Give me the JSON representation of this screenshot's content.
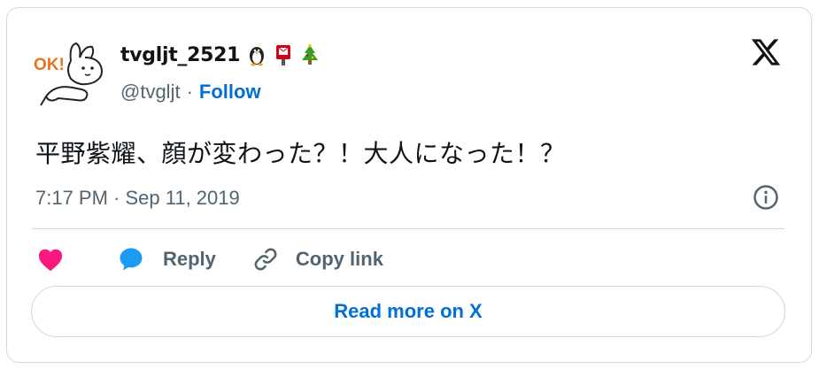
{
  "author": {
    "display_name": "tvgljt_2521",
    "name_emojis": [
      "penguin-emoji",
      "mailbox-emoji",
      "christmas-tree-emoji"
    ],
    "handle": "@tvgljt",
    "separator": "·",
    "follow_label": "Follow",
    "avatar_text": "OK!"
  },
  "tweet": {
    "text": "平野紫耀、顔が変わった？！大人になった！？",
    "timestamp": "7:17 PM · Sep 11, 2019"
  },
  "actions": {
    "like_icon": "heart-icon",
    "reply_label": "Reply",
    "copy_label": "Copy link"
  },
  "footer": {
    "read_more_label": "Read more on X"
  },
  "colors": {
    "accent": "#006fd6",
    "like": "#f91880",
    "reply_icon": "#1d9bf0",
    "secondary_text": "#536471",
    "border": "#cfd9de"
  }
}
